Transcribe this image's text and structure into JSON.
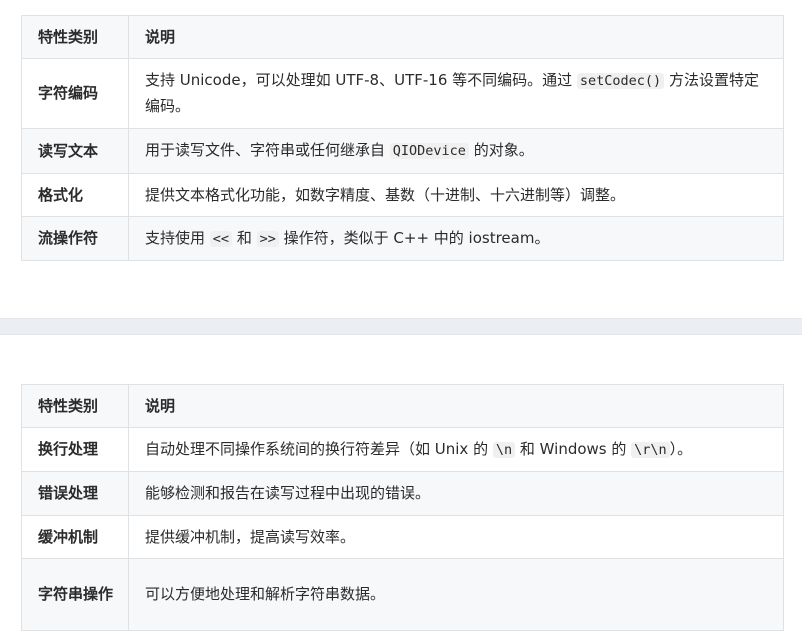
{
  "table1": {
    "headers": [
      "特性类别",
      "说明"
    ],
    "rows": [
      {
        "key": "字符编码",
        "desc": [
          {
            "t": "支持 Unicode，可以处理如 UTF-8、UTF-16 等不同编码。通过 "
          },
          {
            "c": "setCodec()"
          },
          {
            "t": " 方法设置特定编码。"
          }
        ]
      },
      {
        "key": "读写文本",
        "desc": [
          {
            "t": "用于读写文件、字符串或任何继承自 "
          },
          {
            "c": "QIODevice"
          },
          {
            "t": " 的对象。"
          }
        ]
      },
      {
        "key": "格式化",
        "desc": [
          {
            "t": "提供文本格式化功能，如数字精度、基数（十进制、十六进制等）调整。"
          }
        ]
      },
      {
        "key": "流操作符",
        "desc": [
          {
            "t": "支持使用 "
          },
          {
            "c": "<<"
          },
          {
            "t": " 和 "
          },
          {
            "c": ">>"
          },
          {
            "t": " 操作符，类似于 C++ 中的 iostream。"
          }
        ]
      }
    ]
  },
  "table2": {
    "headers": [
      "特性类别",
      "说明"
    ],
    "rows": [
      {
        "key": "换行处理",
        "desc": [
          {
            "t": "自动处理不同操作系统间的换行符差异（如 Unix 的 "
          },
          {
            "c": "\\n"
          },
          {
            "t": " 和 Windows 的 "
          },
          {
            "c": "\\r\\n"
          },
          {
            "t": "）。"
          }
        ]
      },
      {
        "key": "错误处理",
        "desc": [
          {
            "t": "能够检测和报告在读写过程中出现的错误。"
          }
        ]
      },
      {
        "key": "缓冲机制",
        "desc": [
          {
            "t": "提供缓冲机制，提高读写效率。"
          }
        ]
      },
      {
        "key": "字符串操作",
        "desc": [
          {
            "t": "可以方便地处理和解析字符串数据。"
          }
        ]
      }
    ]
  }
}
